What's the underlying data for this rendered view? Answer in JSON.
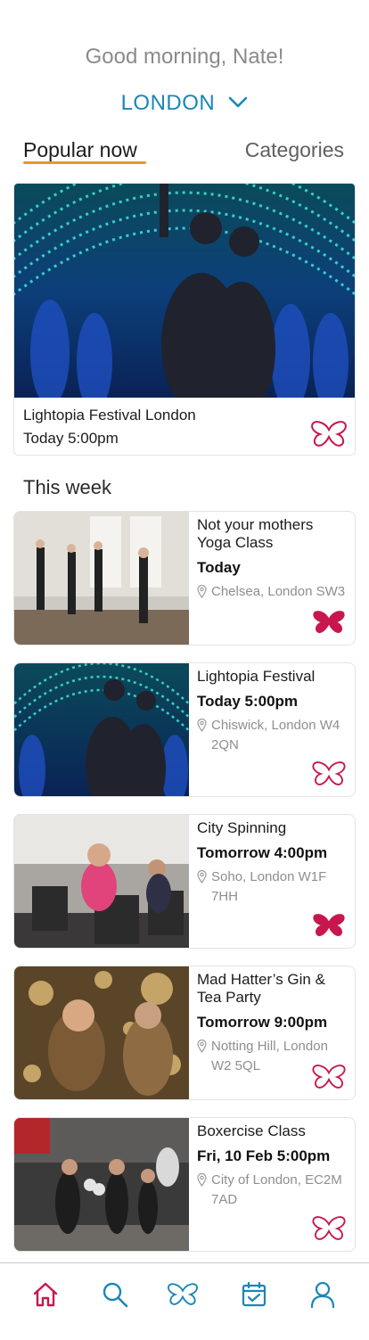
{
  "header": {
    "greeting": "Good morning, Nate!",
    "city": "LONDON"
  },
  "tabs": {
    "popular": "Popular now",
    "categories": "Categories"
  },
  "featured": {
    "title": "Lightopia Festival London",
    "time": "Today 5:00pm",
    "favorited": false
  },
  "this_week": {
    "title": "This week",
    "events": [
      {
        "name": "Not your mothers Yoga Class",
        "when": "Today",
        "location": "Chelsea, London SW3",
        "favorited": true
      },
      {
        "name": "Lightopia Festival",
        "when": "Today 5:00pm",
        "location": "Chiswick, London W4 2QN",
        "favorited": false
      },
      {
        "name": "City Spinning",
        "when": "Tomorrow 4:00pm",
        "location": "Soho, London W1F 7HH",
        "favorited": true
      },
      {
        "name": "Mad Hatter’s Gin & Tea Party",
        "when": "Tomorrow 9:00pm",
        "location": "Notting Hill, London W2 5QL",
        "favorited": false
      },
      {
        "name": "Boxercise Class",
        "when": "Fri, 10 Feb 5:00pm",
        "location": "City of London, EC2M 7AD",
        "favorited": false
      }
    ]
  },
  "nav": {
    "items": [
      "home-icon",
      "search-icon",
      "butterfly-icon",
      "calendar-icon",
      "profile-icon"
    ],
    "active": "home-icon"
  },
  "colors": {
    "accent_blue": "#1a87b5",
    "tab_underline": "#e8952f",
    "favorite": "#c8174e",
    "nav_icon": "#1a87b5",
    "nav_active": "#c8174e"
  }
}
